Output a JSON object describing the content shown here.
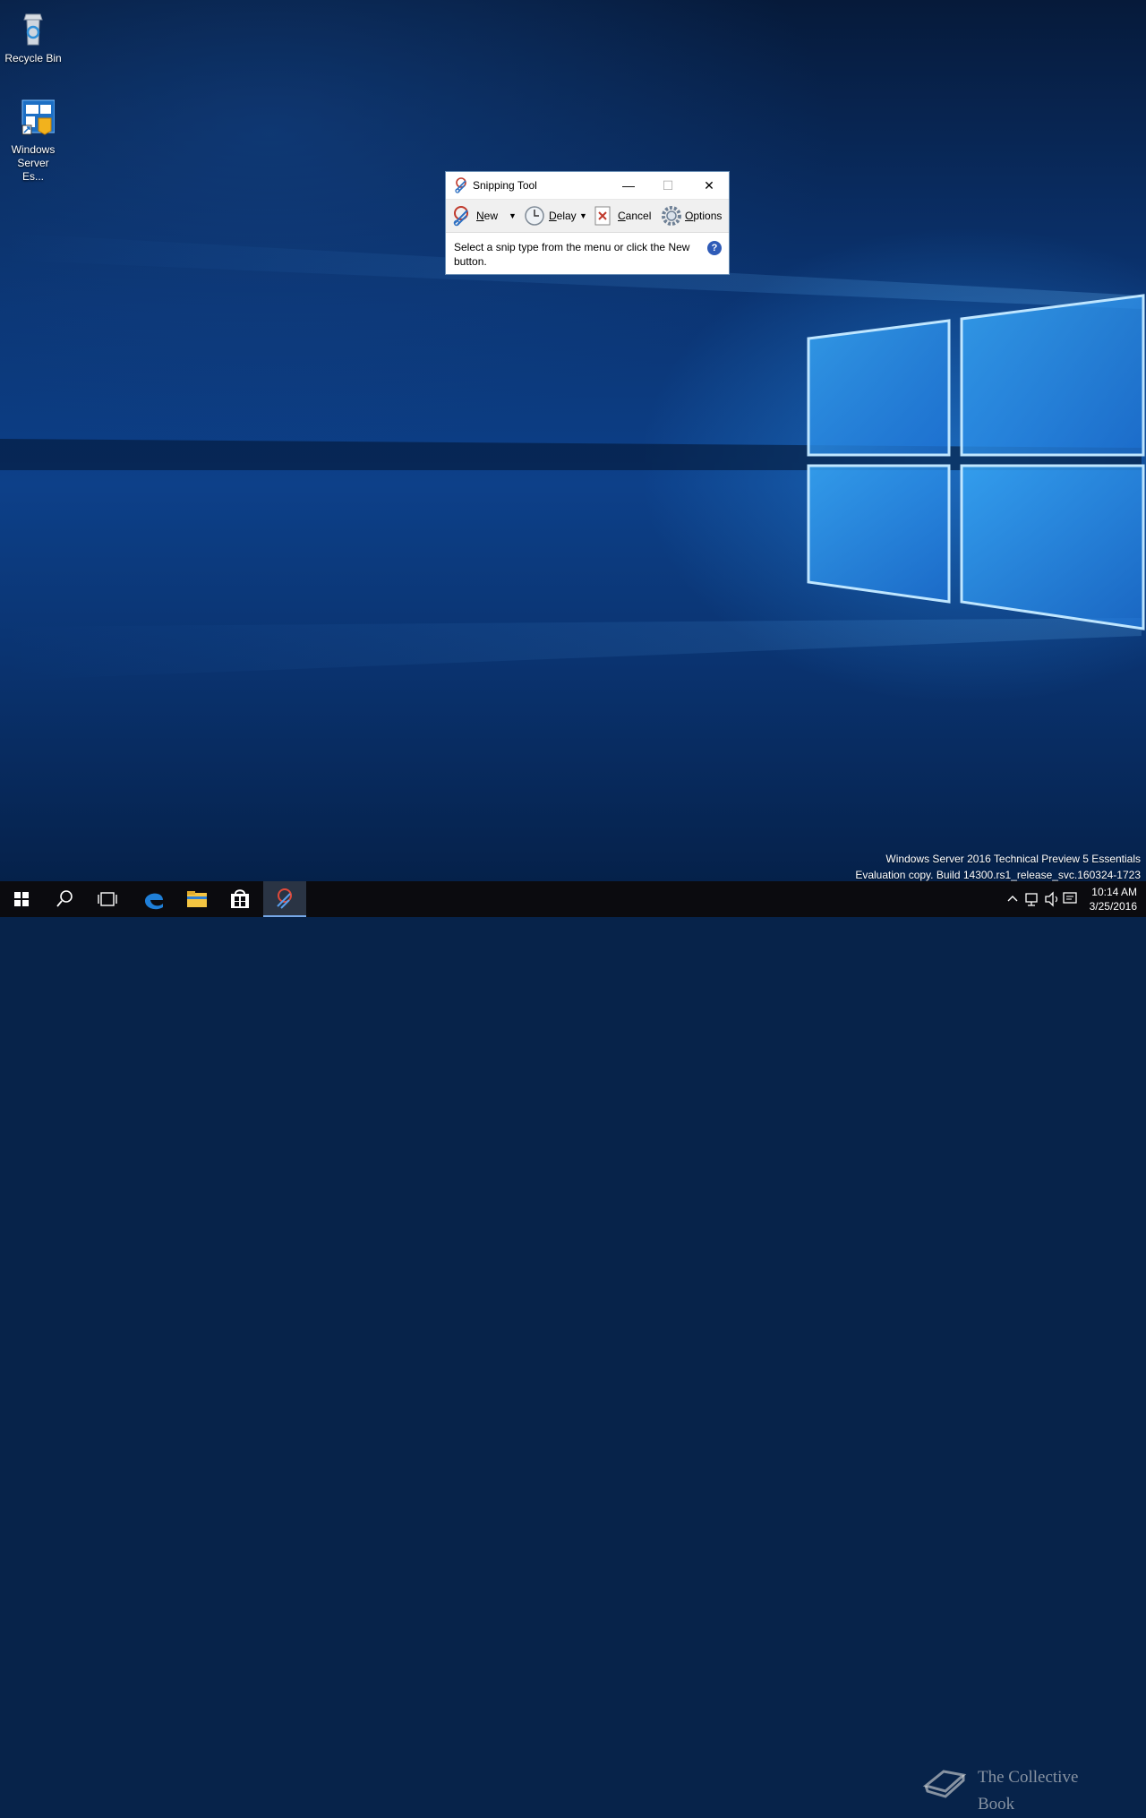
{
  "desktop": {
    "icons": [
      {
        "label": "Recycle Bin"
      },
      {
        "label": "Windows Server Es..."
      }
    ]
  },
  "snipping_tool": {
    "title": "Snipping Tool",
    "minimize": "—",
    "maximize": "☐",
    "close": "✕",
    "toolbar": {
      "new_label": "New",
      "delay_label": "Delay",
      "cancel_label": "Cancel",
      "options_label": "Options"
    },
    "message": "Select a snip type from the menu or click the New button.",
    "help": "?"
  },
  "watermark": {
    "line1": "Windows Server 2016 Technical Preview 5 Essentials",
    "line2": "Evaluation copy. Build 14300.rs1_release_svc.160324-1723"
  },
  "taskbar": {
    "apps": [
      "start-icon",
      "search-icon",
      "task-view-icon",
      "edge-icon",
      "file-explorer-icon",
      "store-icon",
      "snipping-tool-icon"
    ],
    "overlay_text": "The Collective Book",
    "clock_time": "10:14 AM",
    "clock_date": "3/25/2016"
  },
  "colors": {
    "accent": "#1e6fd9",
    "taskbar": "#0b0b0f"
  }
}
